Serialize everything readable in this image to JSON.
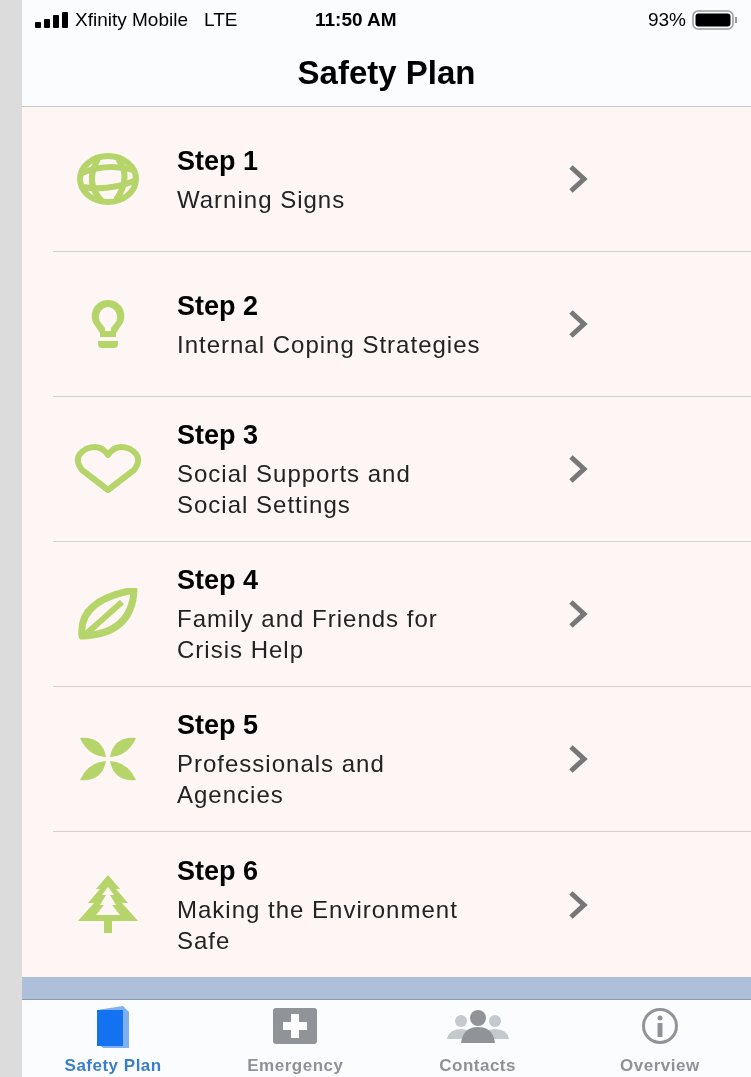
{
  "status_bar": {
    "carrier": "Xfinity Mobile",
    "network": "LTE",
    "time": "11:50 AM",
    "battery": "93%"
  },
  "title": "Safety Plan",
  "steps": [
    {
      "title": "Step 1",
      "subtitle": "Warning Signs"
    },
    {
      "title": "Step 2",
      "subtitle": "Internal Coping Strategies"
    },
    {
      "title": "Step 3",
      "subtitle": "Social Supports and Social Settings"
    },
    {
      "title": "Step 4",
      "subtitle": "Family and Friends for Crisis Help"
    },
    {
      "title": "Step 5",
      "subtitle": "Professionals and Agencies"
    },
    {
      "title": "Step 6",
      "subtitle": "Making the Environment Safe"
    }
  ],
  "tabs": [
    {
      "label": "Safety Plan",
      "selected": true
    },
    {
      "label": "Emergency",
      "selected": false
    },
    {
      "label": "Contacts",
      "selected": false
    },
    {
      "label": "Overview",
      "selected": false
    }
  ]
}
